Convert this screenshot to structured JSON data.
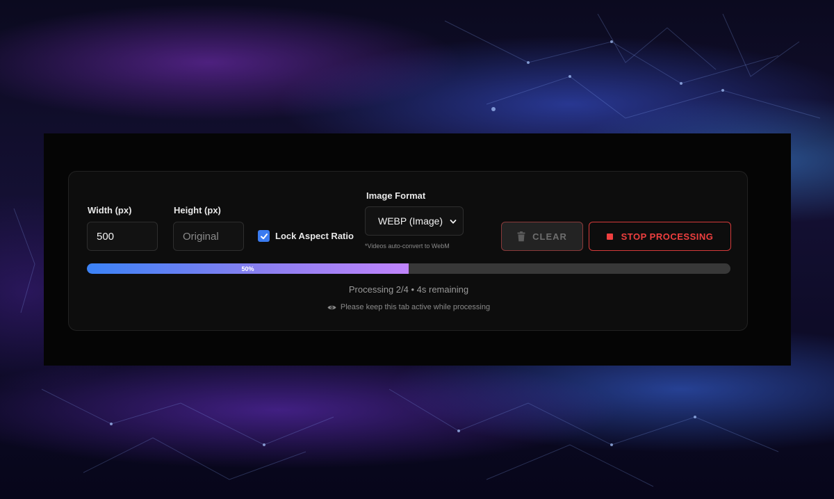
{
  "settings": {
    "width_label": "Width (px)",
    "width_value": "500",
    "height_label": "Height (px)",
    "height_placeholder": "Original",
    "lock_label": "Lock Aspect Ratio",
    "lock_checked": true,
    "format_label": "Image Format",
    "format_selected": "WEBP (Image)",
    "format_hint": "*Videos auto-convert to WebM"
  },
  "actions": {
    "clear_label": "CLEAR",
    "stop_label": "STOP PROCESSING"
  },
  "progress": {
    "percent": 50,
    "percent_label": "50%",
    "status": "Processing 2/4 • 4s remaining",
    "notice": "Please keep this tab active while processing"
  },
  "colors": {
    "accent_blue": "#3b82f6",
    "accent_purple": "#c084fc",
    "danger": "#ef3f3f"
  },
  "icons": {
    "clear": "trash-icon",
    "stop": "stop-icon",
    "notice": "eye-icon",
    "lock": "checkmark-icon",
    "select": "chevron-down-icon"
  }
}
